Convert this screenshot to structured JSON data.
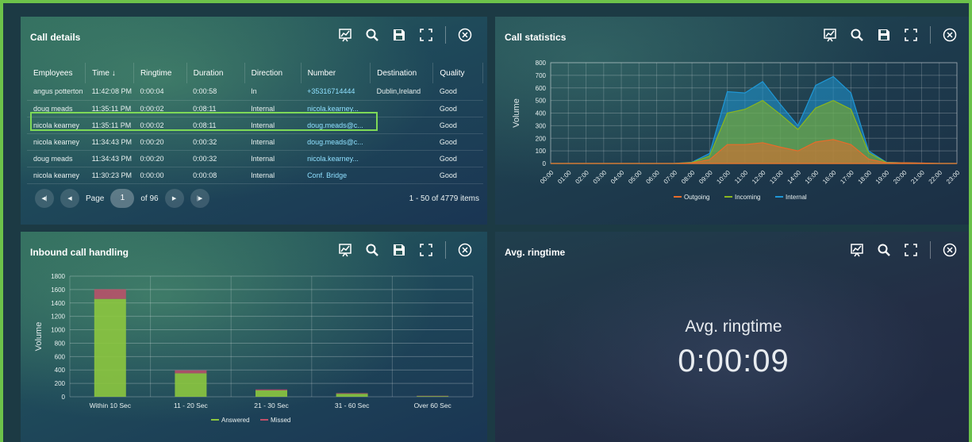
{
  "colors": {
    "accent": "#6cc24a",
    "outgoing": "#e86b2a",
    "incoming": "#8ab61e",
    "internal": "#1e97d6",
    "answered": "#8cc63f",
    "missed": "#c0506a"
  },
  "panels": {
    "call_details": {
      "title": "Call details",
      "columns": [
        "Employees",
        "Time ↓",
        "Ringtime",
        "Duration",
        "Direction",
        "Number",
        "Destination",
        "Quality"
      ],
      "rows": [
        [
          "angus potterton",
          "11:42:08 PM",
          "0:00:04",
          "0:00:58",
          "In",
          "+35316714444",
          "Dublin,Ireland",
          "Good"
        ],
        [
          "doug meads",
          "11:35:11 PM",
          "0:00:02",
          "0:08:11",
          "Internal",
          "nicola.kearney...",
          "",
          "Good"
        ],
        [
          "nicola kearney",
          "11:35:11 PM",
          "0:00:02",
          "0:08:11",
          "Internal",
          "doug.meads@c...",
          "",
          "Good"
        ],
        [
          "nicola kearney",
          "11:34:43 PM",
          "0:00:20",
          "0:00:32",
          "Internal",
          "doug.meads@c...",
          "",
          "Good"
        ],
        [
          "doug meads",
          "11:34:43 PM",
          "0:00:20",
          "0:00:32",
          "Internal",
          "nicola.kearney...",
          "",
          "Good"
        ],
        [
          "nicola kearney",
          "11:30:23 PM",
          "0:00:00",
          "0:00:08",
          "Internal",
          "Conf. Bridge",
          "",
          "Good"
        ]
      ],
      "pager": {
        "page_label": "Page",
        "page": "1",
        "of_label": "of 96",
        "items": "1 - 50 of 4779 items"
      }
    },
    "call_statistics": {
      "title": "Call statistics"
    },
    "inbound": {
      "title": "Inbound call handling"
    },
    "avg_ringtime": {
      "title": "Avg. ringtime",
      "label": "Avg. ringtime",
      "value": "0:00:09"
    }
  },
  "chart_data": [
    {
      "type": "area",
      "title": "",
      "ylabel": "Volume",
      "ylim": [
        0,
        800
      ],
      "yticks": [
        0,
        100,
        200,
        300,
        400,
        500,
        600,
        700,
        800
      ],
      "grid": true,
      "legend_position": "bottom",
      "x": [
        "00:00",
        "01:00",
        "02:00",
        "03:00",
        "04:00",
        "05:00",
        "06:00",
        "07:00",
        "08:00",
        "09:00",
        "10:00",
        "11:00",
        "12:00",
        "13:00",
        "14:00",
        "15:00",
        "16:00",
        "17:00",
        "18:00",
        "19:00",
        "20:00",
        "21:00",
        "22:00",
        "23:00"
      ],
      "series": [
        {
          "name": "Outgoing",
          "values": [
            0,
            0,
            0,
            0,
            0,
            0,
            0,
            0,
            5,
            30,
            150,
            150,
            165,
            130,
            100,
            170,
            190,
            150,
            35,
            5,
            5,
            3,
            0,
            0
          ]
        },
        {
          "name": "Incoming",
          "values": [
            0,
            0,
            0,
            0,
            0,
            0,
            0,
            0,
            8,
            60,
            400,
            430,
            500,
            390,
            270,
            440,
            500,
            430,
            85,
            8,
            5,
            2,
            0,
            0
          ]
        },
        {
          "name": "Internal",
          "values": [
            0,
            0,
            0,
            0,
            0,
            0,
            0,
            0,
            10,
            80,
            570,
            560,
            650,
            470,
            300,
            620,
            690,
            560,
            100,
            10,
            5,
            3,
            0,
            0
          ]
        }
      ]
    },
    {
      "type": "bar",
      "title": "",
      "ylabel": "Volume",
      "ylim": [
        0,
        1800
      ],
      "yticks": [
        0,
        200,
        400,
        600,
        800,
        1000,
        1200,
        1400,
        1600,
        1800
      ],
      "grid": true,
      "legend_position": "bottom",
      "stacked": true,
      "categories": [
        "Within 10 Sec",
        "11 - 20 Sec",
        "21 - 30 Sec",
        "31 - 60 Sec",
        "Over 60 Sec"
      ],
      "series": [
        {
          "name": "Answered",
          "values": [
            1460,
            350,
            95,
            45,
            10
          ]
        },
        {
          "name": "Missed",
          "values": [
            145,
            45,
            15,
            10,
            5
          ]
        }
      ]
    }
  ]
}
